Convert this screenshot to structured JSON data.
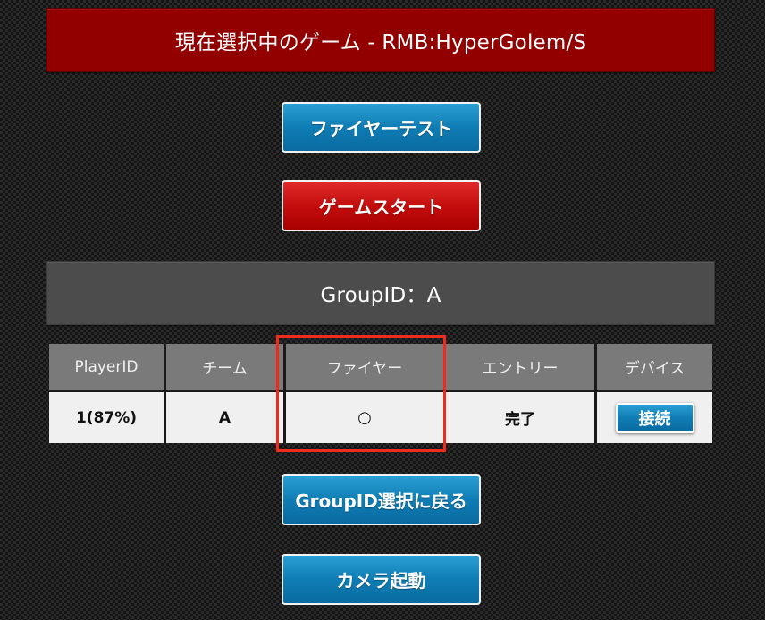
{
  "header": {
    "title": "現在選択中のゲーム - RMB:HyperGolem/S"
  },
  "buttons": {
    "fire_test": "ファイヤーテスト",
    "game_start": "ゲームスタート",
    "back_to_group": "GroupID選択に戻る",
    "camera_start": "カメラ起動"
  },
  "group": {
    "title": "GroupID：A"
  },
  "table": {
    "headers": [
      "PlayerID",
      "チーム",
      "ファイヤー",
      "エントリー",
      "デバイス"
    ],
    "rows": [
      {
        "player_id": "1(87%)",
        "team": "A",
        "fire": "○",
        "entry": "完了",
        "device_button": "接続"
      }
    ]
  },
  "colors": {
    "header_red": "#930000",
    "group_gray": "#4c4c4c",
    "button_blue": "#0f7db5",
    "button_red": "#c40d0d",
    "highlight": "#ee2b1d"
  }
}
